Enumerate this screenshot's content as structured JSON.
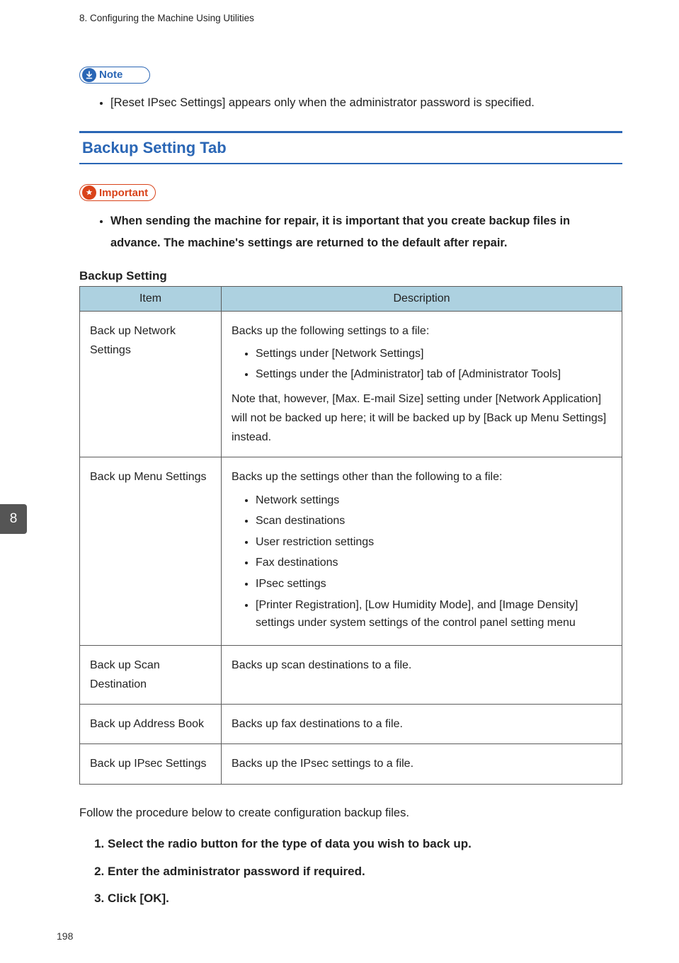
{
  "header": {
    "chapter": "8. Configuring the Machine Using Utilities"
  },
  "sideTab": "8",
  "pageNumber": "198",
  "note": {
    "label": "Note",
    "items": [
      "[Reset IPsec Settings] appears only when the administrator password is specified."
    ]
  },
  "section": {
    "heading": "Backup Setting Tab"
  },
  "important": {
    "label": "Important",
    "items": [
      "When sending the machine for repair, it is important that you create backup files in advance. The machine's settings are returned to the default after repair."
    ]
  },
  "table": {
    "caption": "Backup Setting",
    "headers": {
      "item": "Item",
      "description": "Description"
    },
    "rows": [
      {
        "item": "Back up Network Settings",
        "lead": "Backs up the following settings to a file:",
        "bullets": [
          "Settings under [Network Settings]",
          "Settings under the [Administrator] tab of [Administrator Tools]"
        ],
        "note": "Note that, however, [Max. E-mail Size] setting under [Network Application] will not be backed up here; it will be backed up by [Back up Menu Settings] instead."
      },
      {
        "item": "Back up Menu Settings",
        "lead": "Backs up the settings other than the following to a file:",
        "bullets": [
          "Network settings",
          "Scan destinations",
          "User restriction settings",
          "Fax destinations",
          "IPsec settings",
          "[Printer Registration], [Low Humidity Mode], and [Image Density] settings under system settings of the control panel setting menu"
        ]
      },
      {
        "item": "Back up Scan Destination",
        "lead": "Backs up scan destinations to a file."
      },
      {
        "item": "Back up Address Book",
        "lead": "Backs up fax destinations to a file."
      },
      {
        "item": "Back up IPsec Settings",
        "lead": "Backs up the IPsec settings to a file."
      }
    ]
  },
  "afterTable": "Follow the procedure below to create configuration backup files.",
  "steps": [
    "Select the radio button for the type of data you wish to back up.",
    "Enter the administrator password if required.",
    "Click [OK]."
  ]
}
